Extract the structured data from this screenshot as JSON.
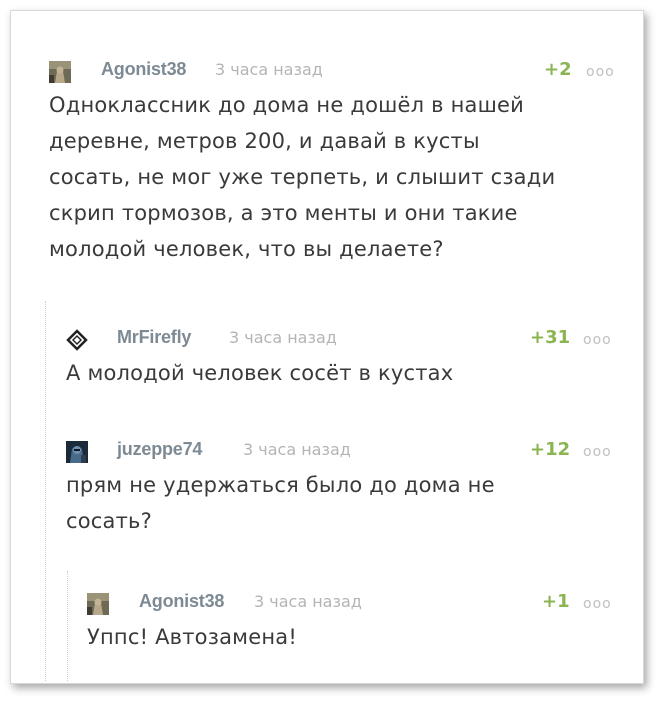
{
  "comments": [
    {
      "author": "Agonist38",
      "time": "3 часа назад",
      "rating": "+2",
      "more": "ooo",
      "text": "Одноклассник до дома не дошёл в нашей\nдеревне, метров 200, и давай в кусты\nсосать, не мог уже терпеть, и слышит сзади\nскрип тормозов, а это менты и они такие\nмолодой человек, что вы делаете?"
    },
    {
      "author": "MrFirefly",
      "time": "3 часа назад",
      "rating": "+31",
      "more": "ooo",
      "text": "А молодой человек сосёт в кустах"
    },
    {
      "author": "juzeppe74",
      "time": "3 часа назад",
      "rating": "+12",
      "more": "ooo",
      "text": "прям не удержаться было до дома не\nсосать?"
    },
    {
      "author": "Agonist38",
      "time": "3 часа назад",
      "rating": "+1",
      "more": "ooo",
      "text": "Уппс! Автозамена!"
    }
  ],
  "colors": {
    "author": "#7d8a94",
    "time": "#b4b4b4",
    "rating": "#8ab552",
    "text": "#3a3a3a"
  }
}
